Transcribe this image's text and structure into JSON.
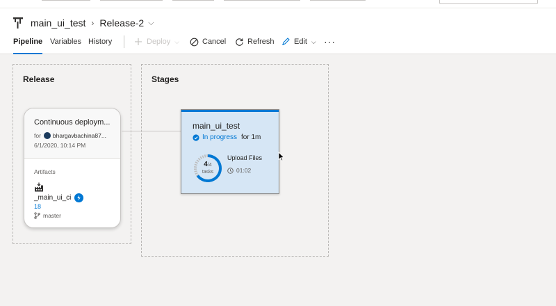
{
  "header": {
    "pipeline_name": "main_ui_test",
    "release_name": "Release-2"
  },
  "tabs": [
    {
      "label": "Pipeline",
      "active": true
    },
    {
      "label": "Variables",
      "active": false
    },
    {
      "label": "History",
      "active": false
    }
  ],
  "commands": {
    "deploy": "Deploy",
    "cancel": "Cancel",
    "refresh": "Refresh",
    "edit": "Edit",
    "more": "···"
  },
  "release_section": {
    "title": "Release",
    "trigger": {
      "title": "Continuous deploym...",
      "for_label": "for",
      "user": "bhargavbachina87...",
      "date": "6/1/2020, 10:14 PM"
    },
    "artifacts": {
      "heading": "Artifacts",
      "name": "_main_ui_ci",
      "build": "18",
      "branch": "master"
    }
  },
  "stages_section": {
    "title": "Stages",
    "stage": {
      "name": "main_ui_test",
      "status": "In progress",
      "duration": "for 1m",
      "tasks_done": "4",
      "tasks_total": "/4",
      "tasks_label": "tasks",
      "current_task": "Upload Files",
      "elapsed": "01:02"
    }
  },
  "colors": {
    "accent": "#0078d4",
    "stage_bg": "#d6e6f5",
    "canvas_bg": "#f3f2f1"
  }
}
